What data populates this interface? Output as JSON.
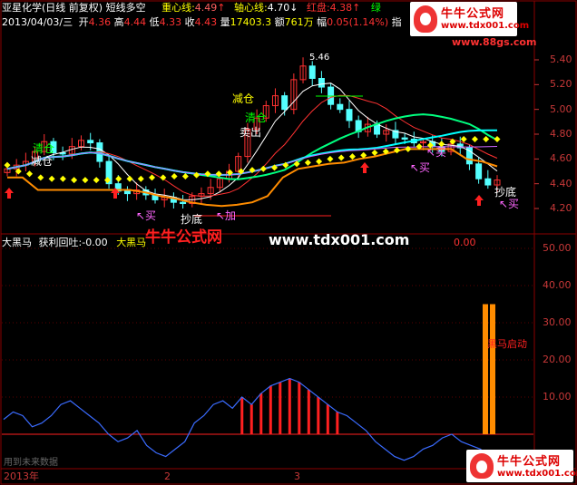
{
  "header": {
    "title": "亚星化学(日线 前复权) 短线多空",
    "center_label": "重心线:",
    "center_value": "4.49",
    "center_arrow": "↑",
    "axis_label": "轴心线:",
    "axis_value": "4.70",
    "axis_arrow": "↓",
    "red_label": "红盘:",
    "red_value": "4.38",
    "red_arrow": "↑",
    "green_label": "绿",
    "date": "2013/04/03/三",
    "open_label": "开",
    "open": "4.36",
    "high_label": "高",
    "high": "4.44",
    "low_label": "低",
    "low": "4.33",
    "close_label": "收",
    "close": "4.43",
    "volume_label": "量",
    "volume": "17403.3",
    "amount_label": "额",
    "amount": "761万",
    "change_label": "幅",
    "change": "0.05(1.14%)",
    "trailing": "指"
  },
  "price_axis": [
    "5.40",
    "5.20",
    "5.00",
    "4.80",
    "4.60",
    "4.40",
    "4.20"
  ],
  "indicator_axis": [
    "50.00",
    "40.00",
    "30.00",
    "20.00",
    "10.00"
  ],
  "price_annotations": {
    "peak": "5.46",
    "reduce1": "减仓",
    "clear1": "清仓",
    "sell": "卖出",
    "clear_left": "清仓",
    "reduce_left": "减仓",
    "buy1": "↖买",
    "buy2": "↖买",
    "buy3": "↖买",
    "buy4": "↖买",
    "bottom_mid": "抄底",
    "add": "↖加",
    "bottom_right": "抄底"
  },
  "sub_header": {
    "name": "大黑马",
    "profit_label": "获利回吐:",
    "profit_value": "-0.00",
    "name2": "大黑马",
    "tail_value": "0.00"
  },
  "sub_annotation": "黑马启动",
  "footer": {
    "note": "用到未来数据",
    "year": "2013年",
    "month2": "2",
    "month3": "3"
  },
  "watermark": {
    "cn": "牛牛公式网",
    "url": "www.tdx001.com"
  },
  "logos": {
    "cn": "牛牛公式网",
    "url_top": "www.tdx001.com",
    "url_sub": "www.88gs.com",
    "url_bottom": "www.tdx001.com"
  },
  "colors": {
    "bg": "#000000",
    "up": "#ff3232",
    "down": "#54ffff",
    "grid": "#8b0000",
    "yellow": "#ffff00",
    "orange": "#ff8c00"
  },
  "chart_data": [
    {
      "type": "candlestick",
      "title": "亚星化学(日线 前复权) 短线多空",
      "ylim": [
        4.15,
        5.5
      ],
      "x": [
        "2013-01",
        "2013-02",
        "2013-03",
        "2013-04"
      ],
      "closes": [
        4.52,
        4.55,
        4.58,
        4.66,
        4.74,
        4.65,
        4.64,
        4.7,
        4.75,
        4.73,
        4.58,
        4.4,
        4.34,
        4.32,
        4.35,
        4.31,
        4.27,
        4.29,
        4.25,
        4.24,
        4.3,
        4.32,
        4.37,
        4.44,
        4.5,
        4.62,
        4.84,
        4.93,
        5.03,
        5.11,
        5.0,
        5.24,
        5.35,
        5.25,
        5.18,
        5.04,
        5.0,
        4.91,
        4.82,
        4.88,
        4.8,
        4.83,
        4.77,
        4.76,
        4.73,
        4.74,
        4.7,
        4.66,
        4.72,
        4.69,
        4.56,
        4.44,
        4.39,
        4.43
      ],
      "series": [
        {
          "name": "yellow-dots",
          "values": [
            4.55,
            4.5,
            4.48,
            4.45,
            4.44,
            4.44,
            4.43,
            4.43,
            4.43,
            4.43,
            4.44,
            4.44,
            4.44,
            4.45,
            4.45,
            4.46,
            4.46,
            4.47,
            4.48,
            4.48,
            4.49,
            4.5,
            4.51,
            4.52,
            4.53,
            4.55,
            4.56,
            4.57,
            4.58,
            4.6,
            4.61,
            4.62,
            4.63,
            4.65,
            4.66,
            4.67,
            4.68,
            4.7,
            4.71,
            4.72,
            4.74,
            4.76,
            4.76,
            4.76,
            4.76
          ]
        },
        {
          "name": "orange",
          "values": [
            4.45,
            4.45,
            4.35,
            4.35,
            4.35,
            4.35,
            4.35,
            4.35,
            4.35,
            4.33,
            4.3,
            4.28,
            4.25,
            4.23,
            4.22,
            4.23,
            4.25,
            4.3,
            4.45,
            4.52,
            4.54,
            4.56,
            4.57,
            4.6,
            4.62,
            4.65,
            4.68,
            4.68,
            4.68,
            4.68,
            4.6,
            4.58,
            4.54
          ]
        }
      ]
    },
    {
      "type": "line",
      "title": "大黑马",
      "ylim": [
        -5,
        55
      ],
      "values": [
        4,
        6,
        5,
        2,
        3,
        5,
        8,
        9,
        7,
        5,
        3,
        0,
        -2,
        -1,
        1,
        -3,
        -5,
        -6,
        -4,
        -2,
        3,
        5,
        8,
        9,
        7,
        10,
        8,
        11,
        13,
        14,
        15,
        14,
        12,
        10,
        8,
        6,
        5,
        3,
        1,
        -2,
        -4,
        -6,
        -7,
        -6,
        -4,
        -3,
        -1,
        0,
        -2,
        -3,
        -4,
        -6
      ],
      "bars_from": 25,
      "bars_to": 35,
      "signal_index": 51,
      "signal_value": 35
    }
  ]
}
